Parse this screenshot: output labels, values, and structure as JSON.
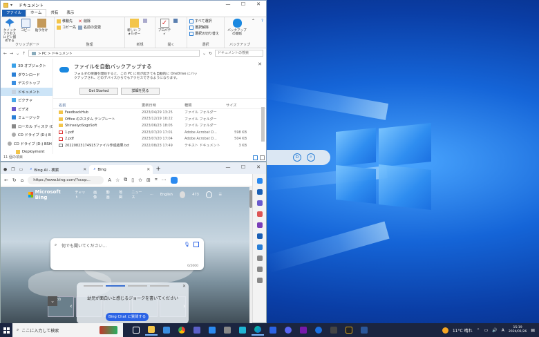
{
  "explorer": {
    "title": "ドキュメント",
    "tabs": [
      "ファイル",
      "ホーム",
      "共有",
      "表示"
    ],
    "ribbon": {
      "clipboard": {
        "label": "クリップボード",
        "pin": "クイック アクセス にピン留めする",
        "copy": "コピー",
        "paste": "貼り付け",
        "cut": "",
        "copypath": ""
      },
      "organize": {
        "label": "整理",
        "move_to": "移動先",
        "copy_to": "コピー先",
        "delete": "削除",
        "rename": "名前の変更"
      },
      "new": {
        "label": "新規",
        "new_folder": "新しい フォルダー"
      },
      "open": {
        "label": "開く",
        "properties": "プロパティ"
      },
      "select": {
        "label": "選択",
        "select_all": "すべて選択",
        "select_none": "選択解除",
        "invert": "選択の切り替え"
      },
      "backup": {
        "label": "バックアップ",
        "start": "バックアップ の開始"
      }
    },
    "address": {
      "path": "> PC > ドキュメント",
      "search_placeholder": "ドキュメントの検索"
    },
    "nav": [
      "3D オブジェクト",
      "ダウンロード",
      "デスクトップ",
      "ドキュメント",
      "ピクチャ",
      "ビデオ",
      "ミュージック",
      "ローカル ディスク (C",
      "CD ドライブ (D:) B",
      "CD ドライブ (D:) BSH",
      "Deployment"
    ],
    "backup_prompt": {
      "title": "ファイルを自動バックアップする",
      "desc": "フォルダの保護を開始すると、この PC に何が起きても自動的に OneDrive にバックアップされ、どのデバイスからでもアクセスできるようになります。",
      "get_started": "Get Started",
      "details": "詳細を見る"
    },
    "columns": [
      "名前",
      "更新日時",
      "種類",
      "サイズ"
    ],
    "files": [
      {
        "name": "FeedbackHub",
        "date": "2023/04/29 13:25",
        "type": "ファイル フォルダー",
        "size": "",
        "kind": "folder"
      },
      {
        "name": "Office のカスタム テンプレート",
        "date": "2023/12/19 10:22",
        "type": "ファイル フォルダー",
        "size": "",
        "kind": "folder"
      },
      {
        "name": "ShinseiyoSogoSoft",
        "date": "2023/06/23 18:05",
        "type": "ファイル フォルダー",
        "size": "",
        "kind": "folder"
      },
      {
        "name": "1.pdf",
        "date": "2023/07/20 17:01",
        "type": "Adobe Acrobat D...",
        "size": "598 KB",
        "kind": "pdf"
      },
      {
        "name": "2.pdf",
        "date": "2023/07/20 17:04",
        "type": "Adobe Acrobat D...",
        "size": "504 KB",
        "kind": "pdf"
      },
      {
        "name": "20220823174915ファイル作成結果.txt",
        "date": "2022/08/23 17:49",
        "type": "テキスト ドキュメント",
        "size": "3 KB",
        "kind": "txt"
      }
    ],
    "status": "11 個の項目"
  },
  "edge": {
    "tabs": [
      {
        "label": "Bing AI - 検索"
      },
      {
        "label": "Bing"
      }
    ],
    "url": "https://www.bing.com/?scop...",
    "page": {
      "brand": "Microsoft Bing",
      "nav": [
        "チャット",
        "画像",
        "動画",
        "地図",
        "ニュース",
        "···"
      ],
      "lang": "English",
      "points": "473",
      "placeholder": "何でも聞いてください...",
      "counter": "0/2000",
      "prompt": "幼児が面白いと感じるジョークを書いてください",
      "cta": "Bing Chat に質問する",
      "thumb_label": "共産党の"
    }
  },
  "taskbar": {
    "search_placeholder": "ここに入力して検索",
    "weather": "11°C 晴れ",
    "time": "15:19",
    "date": "2024/01/26",
    "ime": "A"
  },
  "colors": {
    "accent": "#1a5fb4",
    "bing_button": "#2b63e5",
    "taskbar": "#1b2540"
  }
}
